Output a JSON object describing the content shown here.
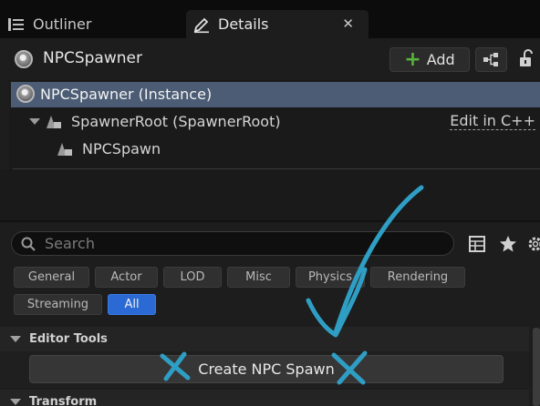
{
  "tabs": [
    {
      "label": "Outliner"
    },
    {
      "label": "Details",
      "close": "✕"
    }
  ],
  "header": {
    "actor_name": "NPCSpawner",
    "add_label": "Add"
  },
  "tree": {
    "instance_label": "NPCSpawner (Instance)",
    "root_label": "SpawnerRoot (SpawnerRoot)",
    "child_label": "NPCSpawn",
    "edit_link": "Edit in C++"
  },
  "search": {
    "placeholder": "Search"
  },
  "filters": [
    "General",
    "Actor",
    "LOD",
    "Misc",
    "Physics",
    "Rendering",
    "Streaming",
    "All"
  ],
  "active_filter": "All",
  "categories": {
    "editor_tools": "Editor Tools",
    "transform": "Transform"
  },
  "create_button_label": "Create NPC Spawn",
  "colors": {
    "selection": "#4b5c74",
    "accent_blue": "#2b6ad4",
    "add_green": "#57b33a",
    "annotation": "#2f9ec4"
  }
}
